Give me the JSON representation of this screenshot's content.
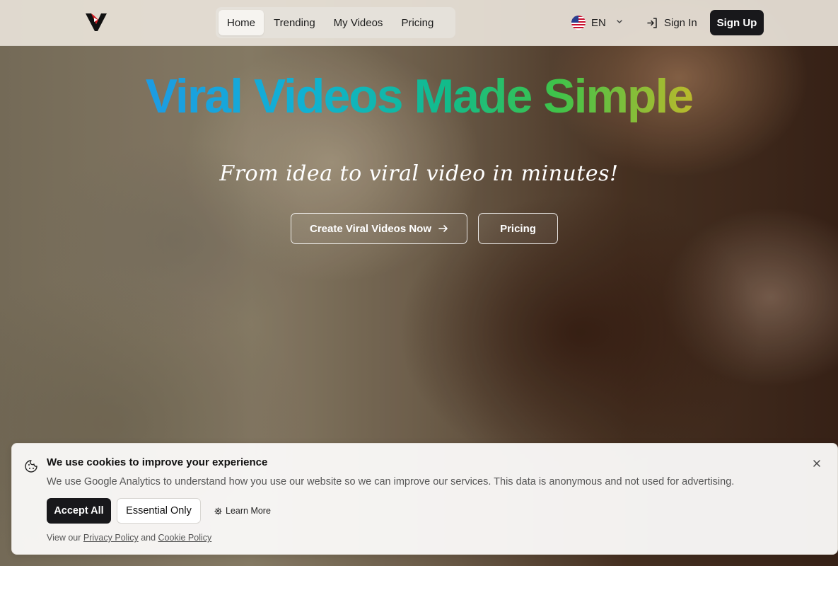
{
  "nav": {
    "items": [
      {
        "label": "Home",
        "active": true
      },
      {
        "label": "Trending",
        "active": false
      },
      {
        "label": "My Videos",
        "active": false
      },
      {
        "label": "Pricing",
        "active": false
      }
    ],
    "language": "EN",
    "language_flag_icon": "us-flag-icon",
    "sign_in": "Sign In",
    "sign_up": "Sign Up"
  },
  "hero": {
    "headline": "Viral Videos Made Simple",
    "tagline": "From idea to viral video in minutes!",
    "cta_primary": "Create Viral Videos Now",
    "cta_secondary": "Pricing"
  },
  "cookie_banner": {
    "title": "We use cookies to improve your experience",
    "text": "We use Google Analytics to understand how you use our website so we can improve our services. This data is anonymous and not used for advertising.",
    "accept": "Accept All",
    "essential": "Essential Only",
    "learn_more": "Learn More",
    "policy_prefix": "View our",
    "privacy_link": "Privacy Policy",
    "and": "and",
    "cookie_link": "Cookie Policy"
  },
  "colors": {
    "dark_button": "#18181b",
    "headline_gradient": [
      "#1d9be3",
      "#10b2d2",
      "#12bb8a",
      "#3fc24a",
      "#b9b92c"
    ]
  }
}
